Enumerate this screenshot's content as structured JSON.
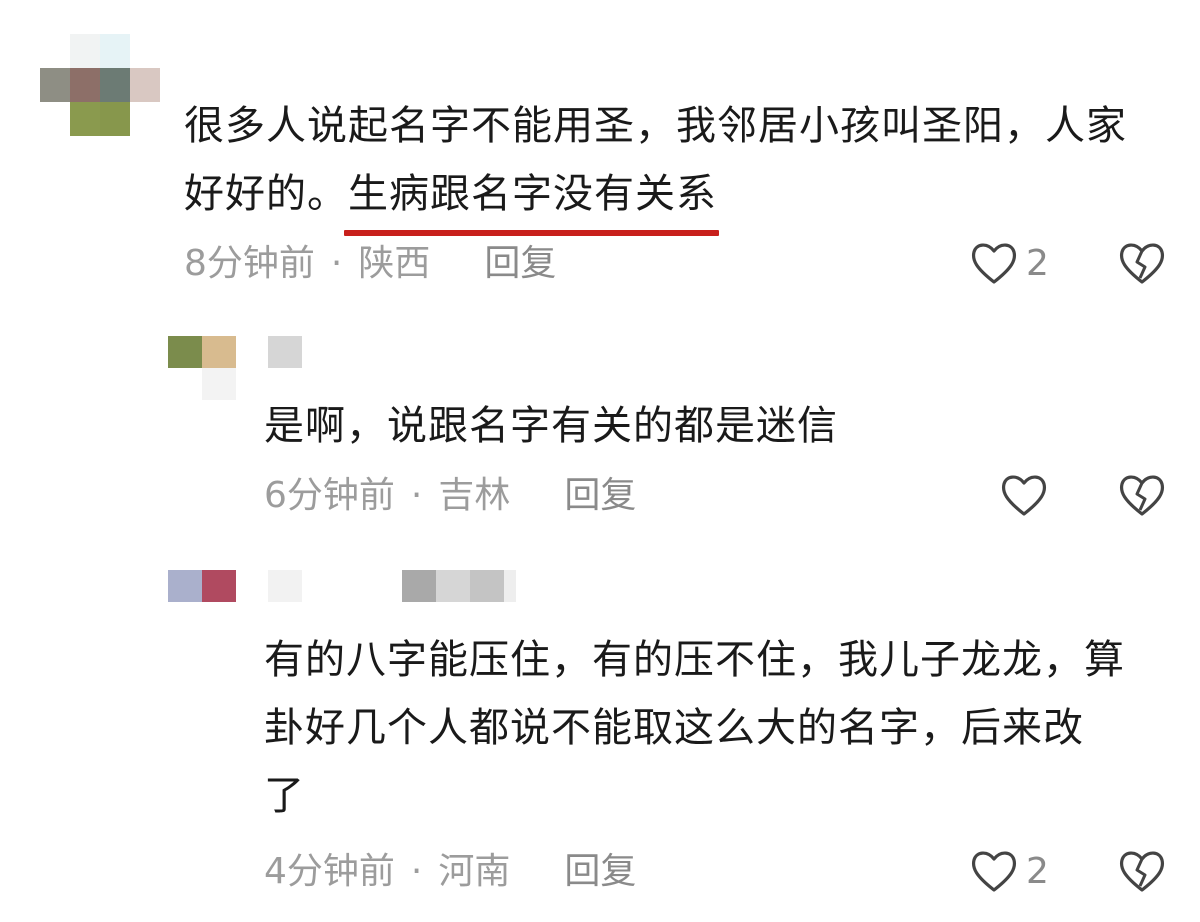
{
  "comments": [
    {
      "text_before": "很多人说起名字不能用圣，我邻居小孩叫圣阳，人家",
      "text_line2_start": "好好的。",
      "text_highlight": "生病跟名字没有关系",
      "time": "8分钟前",
      "location": "陕西",
      "reply_label": "回复",
      "like_count": "2"
    },
    {
      "text": "是啊，说跟名字有关的都是迷信",
      "time": "6分钟前",
      "location": "吉林",
      "reply_label": "回复",
      "like_count": ""
    },
    {
      "text_line1": "有的八字能压住，有的压不住，我儿子龙龙，算",
      "text_line2": "卦好几个人都说不能取这么大的名字，后来改",
      "text_line3": "了",
      "time": "4分钟前",
      "location": "河南",
      "reply_label": "回复",
      "like_count": "2"
    }
  ],
  "meta_separator": "·",
  "icons": {
    "like": "heart-outline-icon",
    "dislike": "broken-heart-icon"
  },
  "colors": {
    "highlight_underline": "#c8201c",
    "text": "#1a1a1a",
    "meta": "#9c9c9c"
  }
}
